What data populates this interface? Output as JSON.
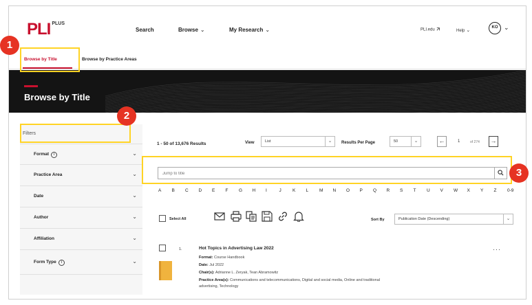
{
  "brand": {
    "logo": "PLI",
    "logo_sup": "PLUS"
  },
  "nav": {
    "search": "Search",
    "browse": "Browse",
    "my_research": "My Research",
    "chevron": "⌄"
  },
  "utility": {
    "plilinks": "PLI.edu",
    "help": "Help",
    "avatar_initials": "KO"
  },
  "tabs": [
    {
      "label": "Browse by Title"
    },
    {
      "label": "Browse by Practice Areas"
    }
  ],
  "banner": {
    "title": "Browse by Title"
  },
  "sidebar": {
    "filters_title": "Filters",
    "items": [
      {
        "label": "Format",
        "info": "i"
      },
      {
        "label": "Practice Area"
      },
      {
        "label": "Date"
      },
      {
        "label": "Author"
      },
      {
        "label": "Affiliation"
      },
      {
        "label": "Form Type",
        "info": "i"
      }
    ]
  },
  "toolbar": {
    "results_count": "1 - 50 of 13,676 Results",
    "view_label": "View",
    "view_value": "List",
    "per_page_label": "Results Per Page",
    "per_page_value": "50",
    "page_current": "1",
    "page_of": "of 274",
    "prev_glyph": "←",
    "next_glyph": "→"
  },
  "search": {
    "placeholder": "Jump to title",
    "search_glyph": "⌕"
  },
  "alphabet": [
    "A",
    "B",
    "C",
    "D",
    "E",
    "F",
    "G",
    "H",
    "I",
    "J",
    "K",
    "L",
    "M",
    "N",
    "O",
    "P",
    "Q",
    "R",
    "S",
    "T",
    "U",
    "V",
    "W",
    "X",
    "Y",
    "Z",
    "0-9"
  ],
  "actions": {
    "select_all": "Select All",
    "sort_label": "Sort By",
    "sort_value": "Publication Date (Descending)"
  },
  "results": [
    {
      "index": "1.",
      "title": "Hot Topics in Advertising Law 2022",
      "format_label": "Format:",
      "format_value": "Course Handbook",
      "date_label": "Date:",
      "date_value": "Jul 2022",
      "chairs_label": "Chair(s):",
      "chairs_value": "Adrianne L. Zeryak, Tean Abramowitz",
      "practice_label": "Practice Area(s):",
      "practice_value": "Communications and telecommunications, Digital and social media, Online and traditional",
      "practice_value_2": "advertising, Technology",
      "more": "···"
    }
  ],
  "annotations": {
    "one": "1",
    "two": "2",
    "three": "3"
  },
  "colors": {
    "brand_red": "#c8102e",
    "highlight_yellow": "#ffd324",
    "badge_red": "#e63323",
    "banner_bg": "#141414",
    "book_orange": "#f0b33e"
  }
}
